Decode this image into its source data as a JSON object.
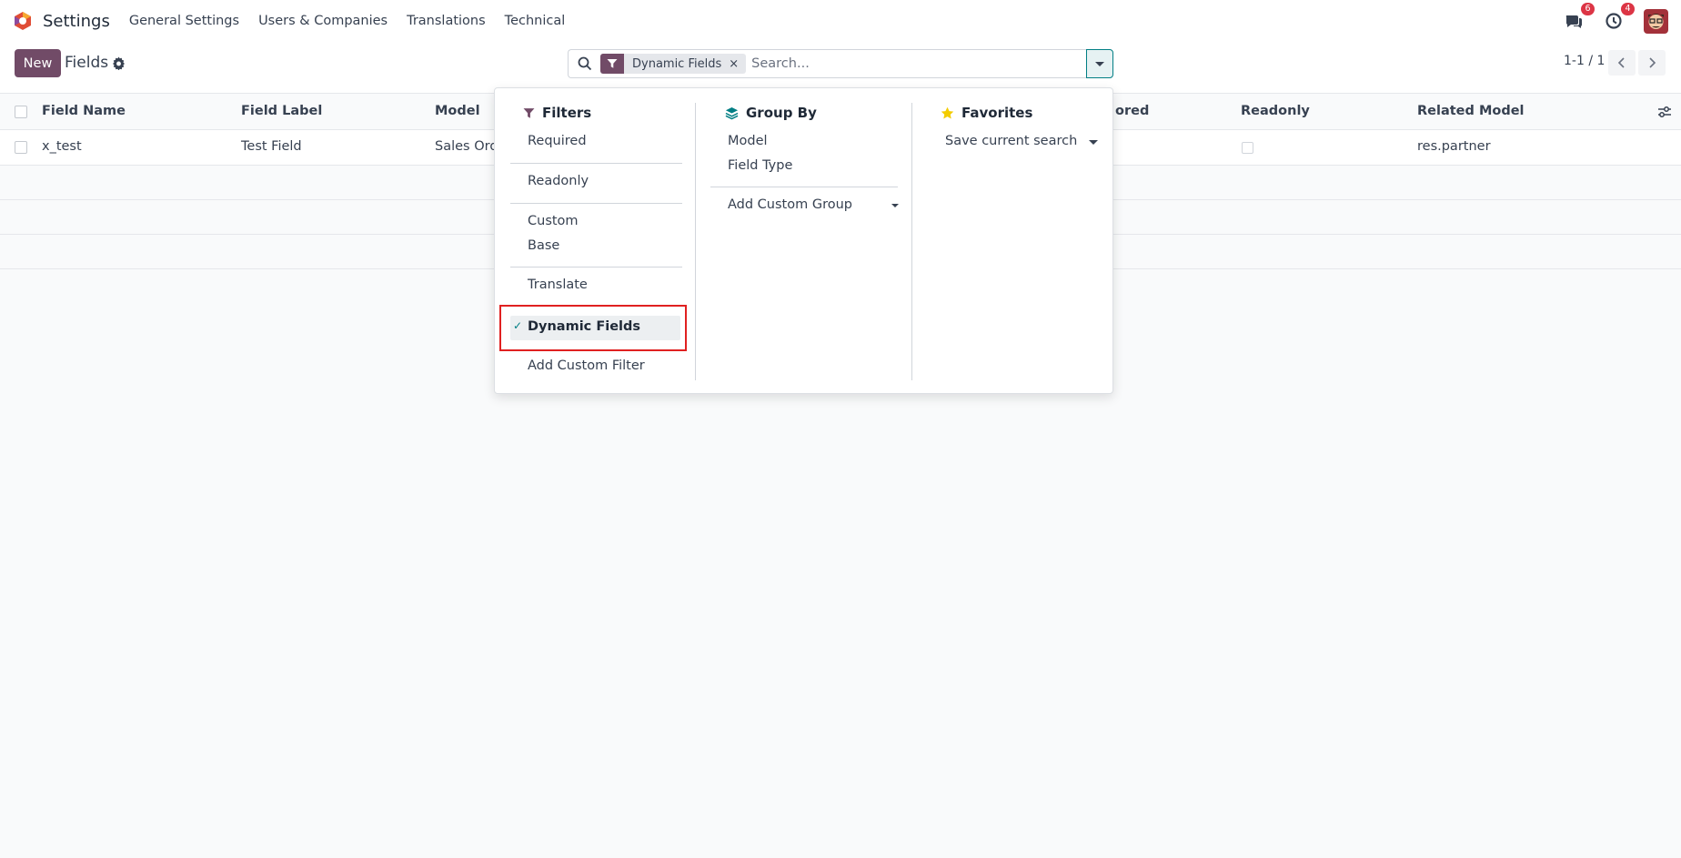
{
  "navbar": {
    "app_name": "Settings",
    "menu": [
      "General Settings",
      "Users & Companies",
      "Translations",
      "Technical"
    ],
    "messages_badge": "6",
    "activities_badge": "4"
  },
  "control_panel": {
    "new_label": "New",
    "breadcrumb": "Fields",
    "search": {
      "facet_label": "Dynamic Fields",
      "facet_close": "×",
      "placeholder": "Search..."
    },
    "pager": "1-1 / 1"
  },
  "table": {
    "columns": [
      "Field Name",
      "Field Label",
      "Model",
      "Stored",
      "Readonly",
      "Related Model"
    ],
    "visible_header_fragments": {
      "stored": "ored"
    },
    "rows": [
      {
        "field_name": "x_test",
        "field_label": "Test Field",
        "model": "Sales Orde",
        "readonly": false,
        "related_model": "res.partner"
      }
    ]
  },
  "dropdown": {
    "filters": {
      "title": "Filters",
      "options": [
        "Required",
        "Readonly",
        "Custom",
        "Base",
        "Translate",
        "Dynamic Fields",
        "Add Custom Filter"
      ],
      "selected": "Dynamic Fields",
      "check": "✓"
    },
    "group_by": {
      "title": "Group By",
      "options": [
        "Model",
        "Field Type",
        "Add Custom Group"
      ]
    },
    "favorites": {
      "title": "Favorites",
      "options": [
        "Save current search"
      ]
    }
  },
  "colors": {
    "primary": "#714b67",
    "accent": "#017e84",
    "badge": "#dc3545",
    "highlight": "#e02020",
    "favorite_star": "#f3cc00"
  }
}
